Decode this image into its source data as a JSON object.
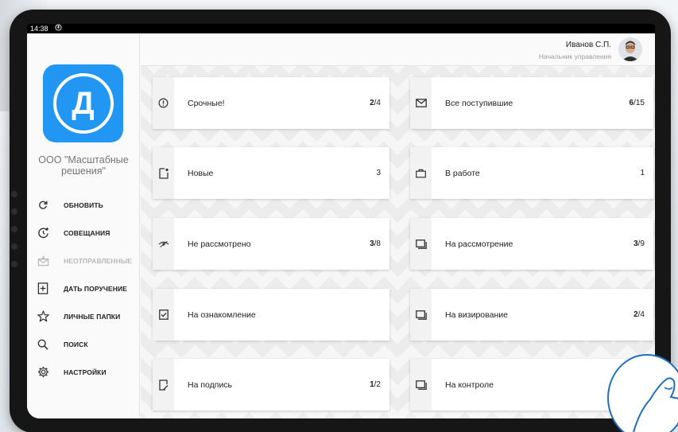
{
  "status": {
    "time": "14:38",
    "icon": "accessibility-icon"
  },
  "org": {
    "logo_letter": "Д",
    "name_line1": "ООО \"Масштабные",
    "name_line2": "решения\""
  },
  "user": {
    "name": "Иванов С.П.",
    "role": "Начальник управления"
  },
  "menu": [
    {
      "label": "ОБНОВИТЬ",
      "icon": "refresh-icon",
      "disabled": false
    },
    {
      "label": "СОВЕЩАНИЯ",
      "icon": "meetings-icon",
      "disabled": false
    },
    {
      "label": "НЕОТПРАВЛЕННЫЕ",
      "icon": "unsent-mail-icon",
      "disabled": true
    },
    {
      "label": "ДАТЬ ПОРУЧЕНИЕ",
      "icon": "add-task-icon",
      "disabled": false
    },
    {
      "label": "ЛИЧНЫЕ ПАПКИ",
      "icon": "star-icon",
      "disabled": false
    },
    {
      "label": "ПОИСК",
      "icon": "search-icon",
      "disabled": false
    },
    {
      "label": "НАСТРОЙКИ",
      "icon": "gear-icon",
      "disabled": false
    }
  ],
  "cards": [
    {
      "label": "Срочные!",
      "count_bold": "2",
      "count_rest": "/4",
      "icon": "alert-circle-icon"
    },
    {
      "label": "Все поступившие",
      "count_bold": "6",
      "count_rest": "/15",
      "icon": "envelope-icon"
    },
    {
      "label": "Новые",
      "count_bold": "",
      "count_rest": "3",
      "icon": "new-document-icon"
    },
    {
      "label": "В работе",
      "count_bold": "",
      "count_rest": "1",
      "icon": "briefcase-icon"
    },
    {
      "label": "Не рассмотрено",
      "count_bold": "3",
      "count_rest": "/8",
      "icon": "eye-off-icon"
    },
    {
      "label": "На рассмотрение",
      "count_bold": "3",
      "count_rest": "/9",
      "icon": "folder-icon"
    },
    {
      "label": "На ознакомление",
      "count_bold": "",
      "count_rest": "",
      "icon": "checkbox-document-icon"
    },
    {
      "label": "На визирование",
      "count_bold": "2",
      "count_rest": "/4",
      "icon": "folder-icon"
    },
    {
      "label": "На подпись",
      "count_bold": "1",
      "count_rest": "/2",
      "icon": "sign-document-icon"
    },
    {
      "label": "На контроле",
      "count_bold": "",
      "count_rest": "",
      "icon": "folder-icon"
    }
  ],
  "colors": {
    "accent": "#2196f3",
    "tablet": "#161616",
    "sidebar": "#fafafa"
  }
}
